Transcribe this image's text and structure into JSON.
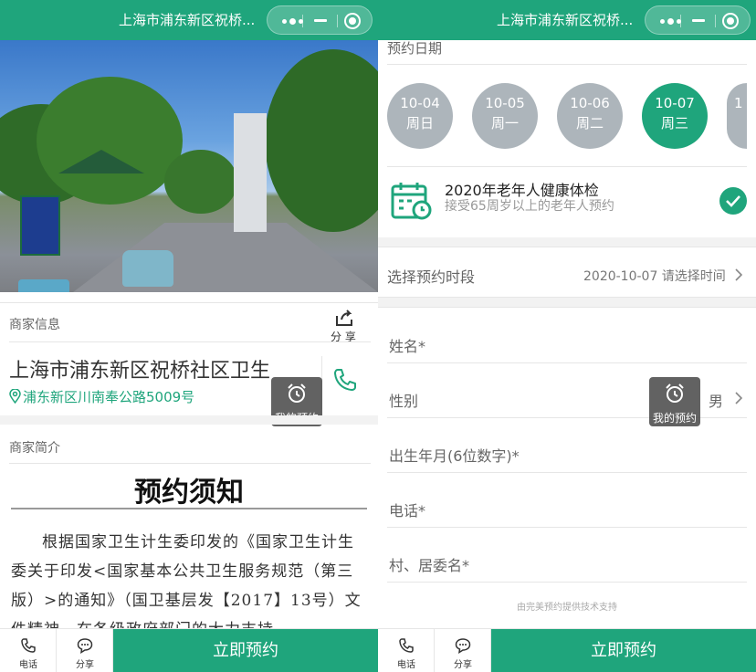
{
  "header": {
    "title": "上海市浦东新区祝桥..."
  },
  "merchant": {
    "section_label": "商家信息",
    "share_label": "分 享",
    "name": "上海市浦东新区祝桥社区卫生",
    "address": "浦东新区川南奉公路5009号",
    "intro_label": "商家简介"
  },
  "float_button": {
    "label": "我的预约"
  },
  "notice": {
    "title": "预约须知",
    "body": "根据国家卫生计生委印发的《国家卫生计生委关于印发<国家基本公共卫生服务规范（第三版）>的通知》（国卫基层发【2017】13号）文件精神，在各级政府部门的大力支持"
  },
  "bottom_bar": {
    "phone_label": "电话",
    "share_label": "分享",
    "cta_label": "立即预约"
  },
  "booking": {
    "date_label": "预约日期",
    "dates": [
      {
        "date": "10-04",
        "weekday": "周日",
        "active": false
      },
      {
        "date": "10-05",
        "weekday": "周一",
        "active": false
      },
      {
        "date": "10-06",
        "weekday": "周二",
        "active": false
      },
      {
        "date": "10-07",
        "weekday": "周三",
        "active": true
      },
      {
        "date": "1",
        "weekday": "",
        "active": false
      }
    ],
    "service": {
      "title": "2020年老年人健康体检",
      "subtitle": "接受65周岁以上的老年人预约"
    },
    "timeslot": {
      "label": "选择预约时段",
      "value": "2020-10-07 请选择时间"
    },
    "form": {
      "name_label": "姓名*",
      "gender_label": "性别",
      "gender_value": "男",
      "birth_label": "出生年月(6位数字)*",
      "phone_label": "电话*",
      "village_label": "村、居委名*"
    },
    "footer_note": "由完美预约提供技术支持"
  },
  "colors": {
    "brand_green": "#1fa57c",
    "inactive_date": "#adb5bb"
  },
  "icons": [
    "more-icon",
    "minimize-icon",
    "close-target-icon",
    "share-icon",
    "location-icon",
    "phone-icon",
    "alarm-clock-icon",
    "chat-bubble-icon",
    "calendar-icon",
    "check-icon",
    "chevron-right-icon"
  ]
}
